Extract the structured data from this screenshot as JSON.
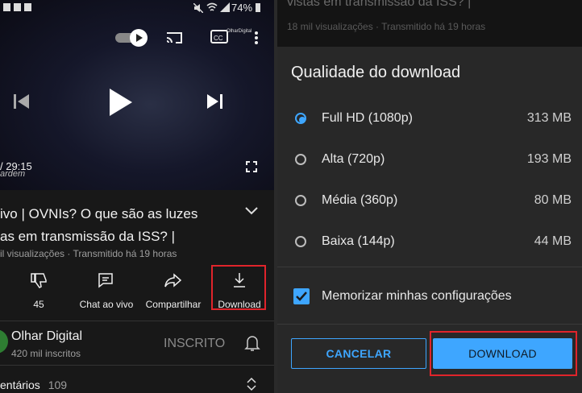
{
  "status_bar": {
    "time_partial": "",
    "battery": "74%"
  },
  "player": {
    "time_label": "/ 29:15",
    "overlay_partial": "ardem",
    "watermark": "OlharDigital"
  },
  "video": {
    "title_line1": "ivo | OVNIs? O que são as luzes",
    "title_line2": "as em transmissão da ISS? |",
    "meta": "il visualizações · Transmitido há 19 horas"
  },
  "actions": [
    {
      "label": "45",
      "icon": "dislike-icon"
    },
    {
      "label": "Chat ao vivo",
      "icon": "chat-icon"
    },
    {
      "label": "Compartilhar",
      "icon": "share-icon"
    },
    {
      "label": "Download",
      "icon": "download-icon"
    }
  ],
  "channel": {
    "name": "Olhar Digital",
    "subs": "420 mil inscritos",
    "subscribe_label": "INSCRITO"
  },
  "comments": {
    "label": "entários",
    "count": "109"
  },
  "right_bg": {
    "title_partial": "vistas em transmissão da ISS? |",
    "meta": "18 mil visualizações · Transmitido há 19 horas"
  },
  "dialog": {
    "title": "Qualidade do download",
    "options": [
      {
        "label": "Full HD (1080p)",
        "size": "313 MB",
        "selected": true
      },
      {
        "label": "Alta (720p)",
        "size": "193 MB",
        "selected": false
      },
      {
        "label": "Média (360p)",
        "size": "80 MB",
        "selected": false
      },
      {
        "label": "Baixa (144p)",
        "size": "44 MB",
        "selected": false
      }
    ],
    "remember_label": "Memorizar minhas configurações",
    "remember_checked": true,
    "cancel_label": "CANCELAR",
    "download_label": "DOWNLOAD"
  },
  "colors": {
    "accent": "#3ea6ff",
    "highlight_box": "#e0242b",
    "dialog_bg": "#282828"
  }
}
